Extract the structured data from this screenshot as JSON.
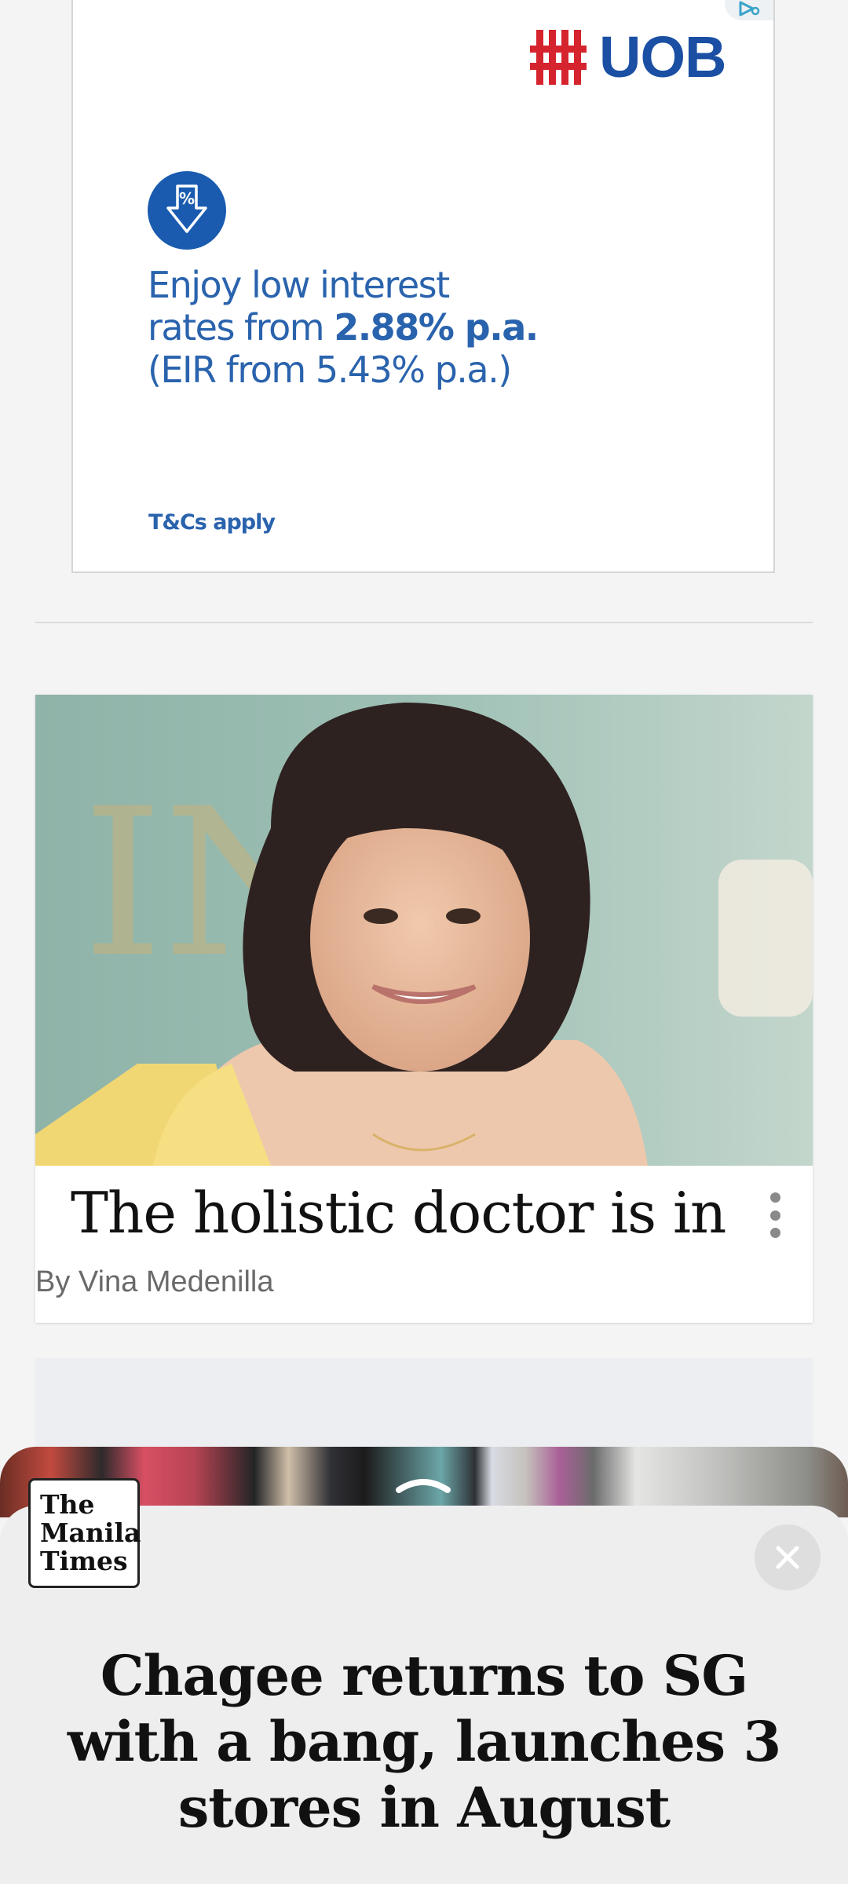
{
  "ad": {
    "brand": "UOB",
    "line1": "Enjoy low interest",
    "line2_prefix": "rates from ",
    "line2_bold": "2.88% p.a.",
    "line3": "(EIR from 5.43% p.a.)",
    "terms": "T&Cs apply",
    "brand_color": "#1a4fa3",
    "logo_mark_color": "#d6242f"
  },
  "article": {
    "title": "The holistic doctor is in",
    "author": "By Vina Medenilla"
  },
  "bottom_sheet": {
    "publisher_logo_lines": [
      "The",
      "Manila",
      "Times"
    ],
    "headline": "Chagee returns to SG with a bang, launches 3 stores in August",
    "close_icon": "close-icon",
    "expand_icon": "chevron-up-icon"
  }
}
